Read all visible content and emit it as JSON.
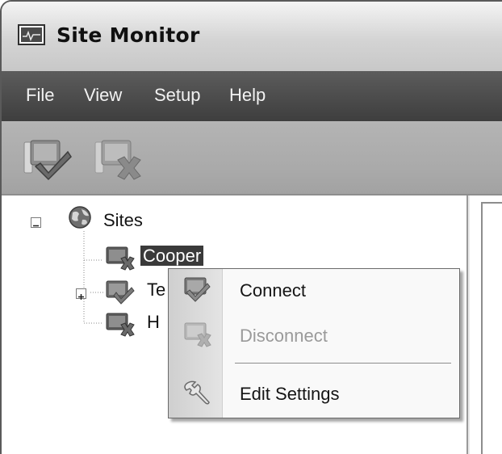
{
  "window": {
    "title": "Site Monitor"
  },
  "menubar": {
    "items": [
      "File",
      "View",
      "Setup",
      "Help"
    ]
  },
  "toolbar": {
    "buttons": [
      {
        "name": "connect-toolbar-button",
        "icon": "connect-icon",
        "enabled": true
      },
      {
        "name": "disconnect-toolbar-button",
        "icon": "disconnect-icon",
        "enabled": false
      }
    ]
  },
  "tree": {
    "root": {
      "label": "Sites",
      "icon": "globe-icon",
      "expanded": true
    },
    "children": [
      {
        "label": "Cooper",
        "selected": true,
        "has_children": false
      },
      {
        "label": "Te",
        "selected": false,
        "has_children": true
      },
      {
        "label": "H",
        "selected": false,
        "has_children": false
      }
    ]
  },
  "context_menu": {
    "items": [
      {
        "label": "Connect",
        "icon": "connect-icon",
        "enabled": true
      },
      {
        "label": "Disconnect",
        "icon": "disconnect-icon",
        "enabled": false
      },
      {
        "label": "Edit Settings",
        "icon": "wrench-icon",
        "enabled": true
      }
    ]
  }
}
